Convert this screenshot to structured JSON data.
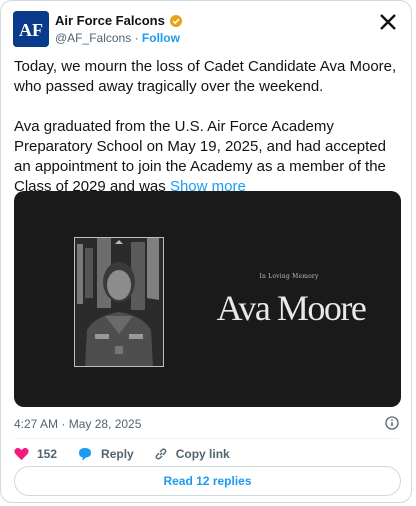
{
  "account": {
    "display_name": "Air Force Falcons",
    "handle": "@AF_Falcons",
    "separator": "·",
    "follow_label": "Follow",
    "avatar_text": "AF",
    "verified_color": "#e8a317"
  },
  "tweet": {
    "paragraph_1": "Today, we mourn the loss of Cadet Candidate Ava Moore, who passed away tragically over the weekend.",
    "paragraph_2": "Ava graduated from the U.S. Air Force Academy Preparatory School on May 19, 2025, and had accepted an appointment to join the Academy as a member of the Class of 2029 and was",
    "show_more_label": "Show more"
  },
  "media": {
    "memory_small_text": "In Loving Memory",
    "memory_name": "Ava Moore"
  },
  "timestamp": "4:27 AM · May 28, 2025",
  "actions": {
    "like_count": "152",
    "reply_label": "Reply",
    "copy_link_label": "Copy link"
  },
  "read_replies_label": "Read 12 replies",
  "colors": {
    "link": "#1d9bf0",
    "like": "#f91880",
    "muted": "#536471"
  },
  "icons": [
    "x-logo-icon",
    "verified-badge-icon",
    "info-icon",
    "heart-icon",
    "reply-icon",
    "link-icon"
  ]
}
